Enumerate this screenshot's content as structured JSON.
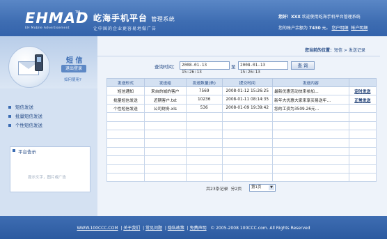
{
  "header": {
    "logo": "EHMAD",
    "logo_tm": "TM",
    "logo_sub": "EH Mobile Advertisement",
    "site_title": "屹海手机平台",
    "site_title_small": "管理系统",
    "slogan": "让中国的企业更容易地做广告",
    "welcome_user": "您好！XXX",
    "welcome_msg": " 欢迎使用屹海手机平台管理系统",
    "balance_prefix": "您的账户余额为 ",
    "balance_value": "7430",
    "balance_unit": " 元。",
    "logout_link": "您户明细",
    "account_link": "帐户明细"
  },
  "sidebar": {
    "sms_title": "短 信",
    "logout": "退出登录",
    "help": "如何使用?",
    "menu": [
      {
        "label": "短信发送"
      },
      {
        "label": "批量短信发送"
      },
      {
        "label": "个性短信发送"
      }
    ],
    "notice_title": "平台告示",
    "notice_text": "提示文字，图片或广告"
  },
  "breadcrumb": {
    "prefix": "您当前的位置：",
    "path": "短信 > 发送记录"
  },
  "query": {
    "label": "查询时间：",
    "from": "2008-01-13 15:26:13",
    "to_label": "至",
    "to": "2008-01-13 15:26:13",
    "button": "查 询"
  },
  "table": {
    "headers": [
      "发送形式",
      "发送给",
      "发送数量(条)",
      "提交时间",
      "发送内容",
      ""
    ],
    "rows": [
      {
        "type": "短信通知",
        "to": "来自的城的客户",
        "count": "7569",
        "time": "2008-01-12 15:26:25",
        "content": "最新优惠活动快来参加…",
        "action": "定时发送"
      },
      {
        "type": "批量短信发送",
        "to": "近期客户.txt",
        "count": "10236",
        "time": "2008-01-11 08:14:35",
        "content": "新年大优惠大家来享买易送年…",
        "action": "正常发送"
      },
      {
        "type": "个性短信发送",
        "to": "公司财务.xls",
        "count": "536",
        "time": "2008-01-09 19:39:42",
        "content": "您的工资为3509.26元…",
        "action": ""
      },
      {
        "type": "",
        "to": "",
        "count": "",
        "time": "",
        "content": "",
        "action": ""
      },
      {
        "type": "",
        "to": "",
        "count": "",
        "time": "",
        "content": "",
        "action": ""
      },
      {
        "type": "",
        "to": "",
        "count": "",
        "time": "",
        "content": "",
        "action": ""
      },
      {
        "type": "",
        "to": "",
        "count": "",
        "time": "",
        "content": "",
        "action": ""
      },
      {
        "type": "",
        "to": "",
        "count": "",
        "time": "",
        "content": "",
        "action": ""
      },
      {
        "type": "",
        "to": "",
        "count": "",
        "time": "",
        "content": "",
        "action": ""
      },
      {
        "type": "",
        "to": "",
        "count": "",
        "time": "",
        "content": "",
        "action": ""
      },
      {
        "type": "",
        "to": "",
        "count": "",
        "time": "",
        "content": "",
        "action": ""
      }
    ]
  },
  "pager": {
    "total": "共23条记录",
    "pages": "分2页",
    "selected": "第1页"
  },
  "footer": {
    "site": "WWW.100CCC.COM",
    "about": "关于我们",
    "faq": "常见问题",
    "privacy": "隐私政策",
    "disclaimer": "免费声明",
    "copyright": "© 2005-2008 100CCC.com. All Rights Reserved"
  }
}
